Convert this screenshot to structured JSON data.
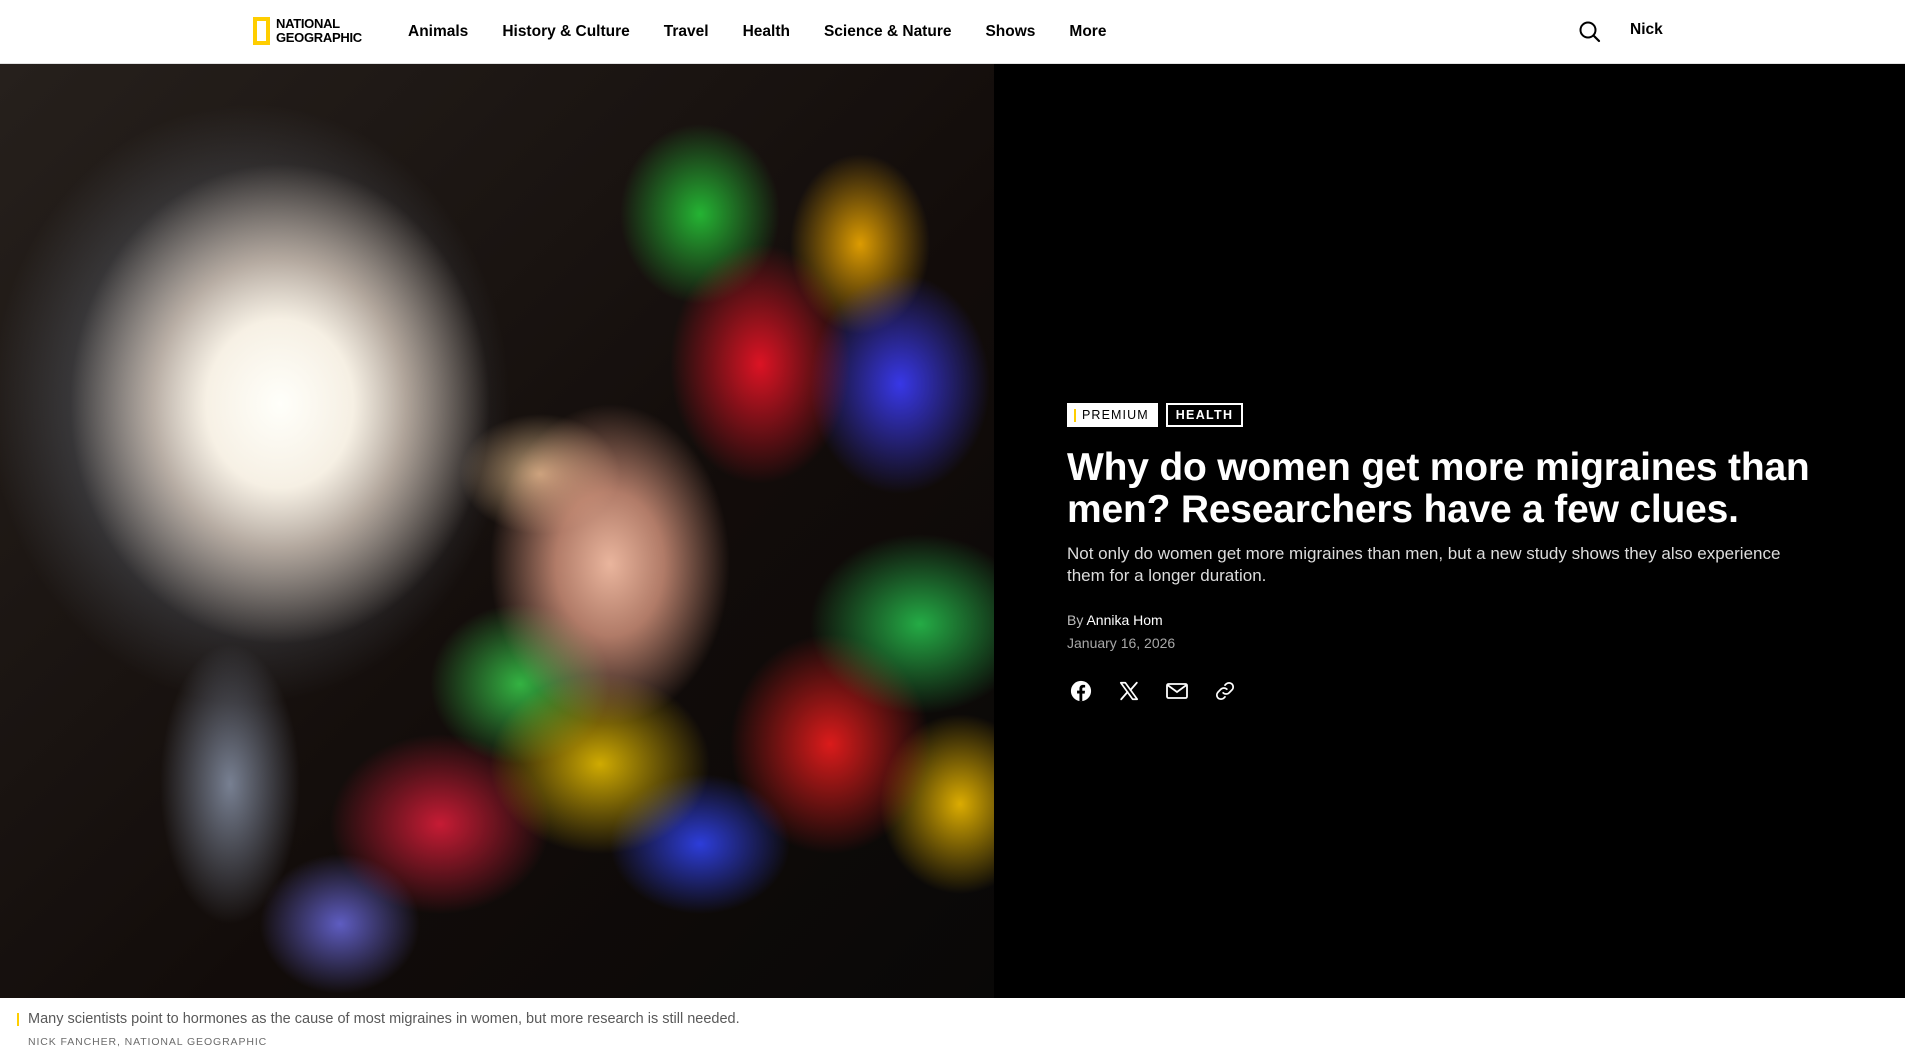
{
  "header": {
    "logo_line1": "NATIONAL",
    "logo_line2": "GEOGRAPHIC",
    "nav": [
      "Animals",
      "History & Culture",
      "Travel",
      "Health",
      "Science & Nature",
      "Shows",
      "More"
    ],
    "search_icon": "search-icon",
    "user_name": "Nick"
  },
  "article": {
    "tags": {
      "premium": "PREMIUM",
      "category": "HEALTH"
    },
    "headline": "Why do women get more migraines than men? Researchers have a few clues.",
    "dek": "Not only do women get more migraines than men, but a new study shows they also experience them for a longer duration.",
    "byline_prefix": "By",
    "author": "Annika Hom",
    "date": "January 16, 2026",
    "share_icons": [
      "facebook-icon",
      "x-icon",
      "email-icon",
      "link-icon"
    ]
  },
  "photo": {
    "caption": "Many scientists point to hormones as the cause of most migraines in women, but more research is still needed.",
    "credit": "NICK FANCHER, NATIONAL GEOGRAPHIC"
  },
  "colors": {
    "accent": "#ffce00",
    "hero_background": "#000000",
    "text_on_dark": "#ffffff"
  }
}
